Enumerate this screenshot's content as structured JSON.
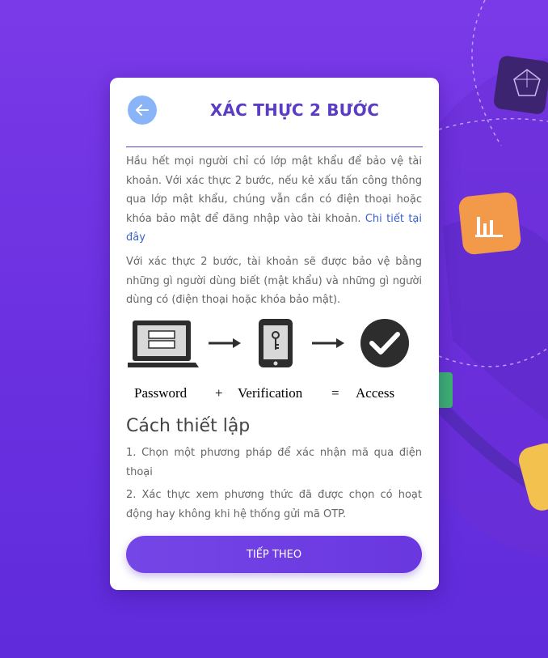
{
  "card": {
    "title": "XÁC THỰC 2 BƯỚC",
    "intro_text": "Hầu hết mọi người chỉ có lớp mật khẩu để bảo vệ tài khoản. Với xác thực 2 bước, nếu kẻ xấu tấn công thông qua lớp mật khẩu, chúng vẫn cần có điện thoại hoặc khóa bảo mật để đăng nhập vào tài khoản.",
    "details_link": "Chi tiết tại đây",
    "explain_text": "Với xác thực 2 bước, tài khoản sẽ được bảo vệ bằng những gì người dùng biết (mật khẩu) và những gì người dùng có (điện thoại hoặc khóa bảo mật).",
    "diagram": {
      "password_label": "Password",
      "plus": "+",
      "verification_label": "Verification",
      "equals": "=",
      "access_label": "Access"
    },
    "setup": {
      "title": "Cách thiết lập",
      "step1": "1. Chọn một phương pháp để xác nhận mã qua điện thoại",
      "step2": "2. Xác thực xem phương thức đã được chọn có hoạt động hay không khi hệ thống gửi mã OTP."
    },
    "next_button": "TIẾP THEO"
  },
  "colors": {
    "background": "#6a30e0",
    "title": "#5b3cc4",
    "link": "#3a62c9",
    "back_button": "#8ab4f8",
    "button": "#6a37e0"
  }
}
